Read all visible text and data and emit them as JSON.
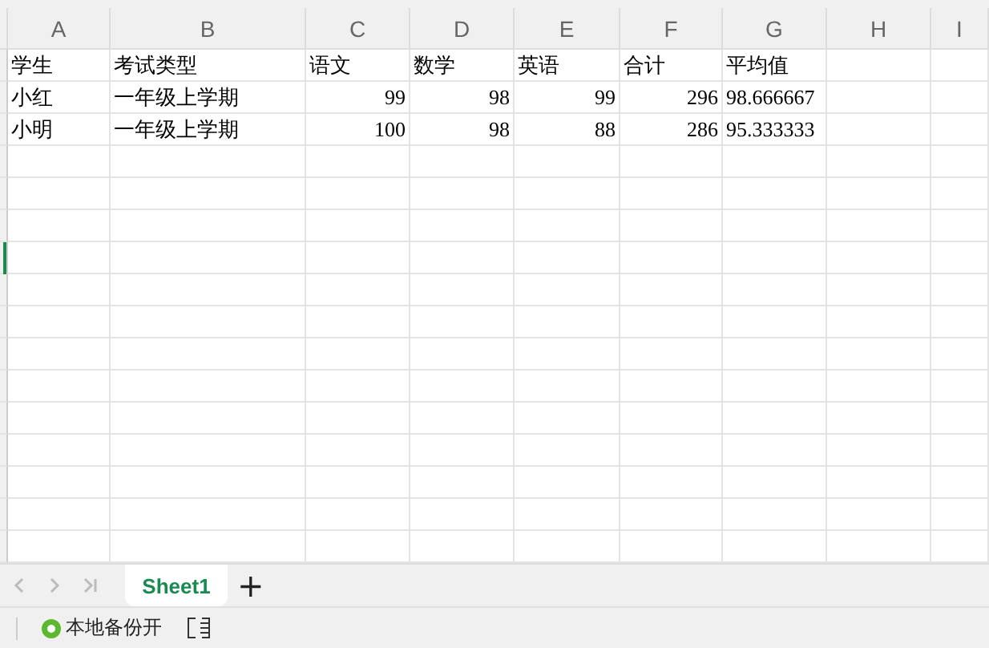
{
  "columns": [
    "A",
    "B",
    "C",
    "D",
    "E",
    "F",
    "G",
    "H",
    "I"
  ],
  "rows": [
    [
      {
        "text": "学生",
        "kind": "text"
      },
      {
        "text": "考试类型",
        "kind": "text"
      },
      {
        "text": "语文",
        "kind": "text"
      },
      {
        "text": "数学",
        "kind": "text"
      },
      {
        "text": "英语",
        "kind": "text"
      },
      {
        "text": "合计",
        "kind": "text"
      },
      {
        "text": "平均值",
        "kind": "text"
      }
    ],
    [
      {
        "text": "小红",
        "kind": "text"
      },
      {
        "text": "一年级上学期",
        "kind": "text"
      },
      {
        "text": "99",
        "kind": "number"
      },
      {
        "text": "98",
        "kind": "number"
      },
      {
        "text": "99",
        "kind": "number"
      },
      {
        "text": "296",
        "kind": "number"
      },
      {
        "text": "98.666667",
        "kind": "text"
      }
    ],
    [
      {
        "text": "小明",
        "kind": "text"
      },
      {
        "text": "一年级上学期",
        "kind": "text"
      },
      {
        "text": "100",
        "kind": "number"
      },
      {
        "text": "98",
        "kind": "number"
      },
      {
        "text": "88",
        "kind": "number"
      },
      {
        "text": "286",
        "kind": "number"
      },
      {
        "text": "95.333333",
        "kind": "text"
      }
    ]
  ],
  "sheet_tabs": [
    {
      "label": "Sheet1",
      "selected": true
    }
  ],
  "add_sheet": "+",
  "status_bar": {
    "backup": "本地备份开"
  }
}
